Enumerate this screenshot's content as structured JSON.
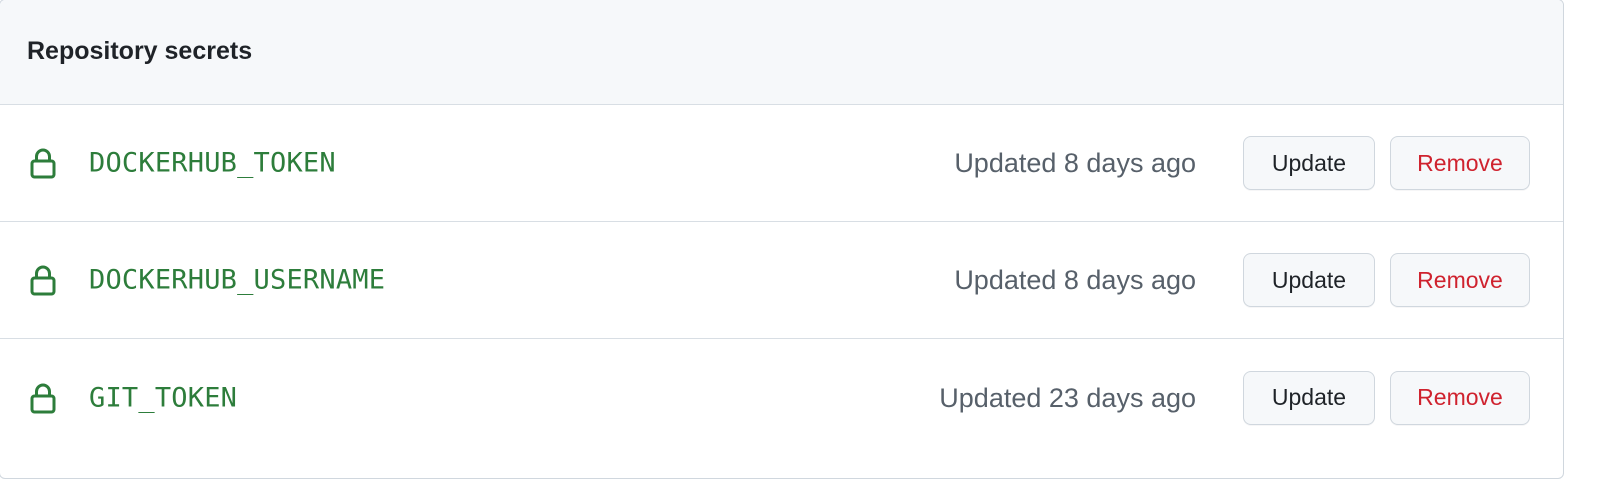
{
  "section": {
    "title": "Repository secrets"
  },
  "colors": {
    "secret_name": "#2d7d3b",
    "updated_text": "#57606a",
    "remove_text": "#cf222e",
    "header_bg": "#f6f8fa"
  },
  "secrets": [
    {
      "icon": "lock-icon",
      "name": "DOCKERHUB_TOKEN",
      "updated": "Updated 8 days ago",
      "update_label": "Update",
      "remove_label": "Remove"
    },
    {
      "icon": "lock-icon",
      "name": "DOCKERHUB_USERNAME",
      "updated": "Updated 8 days ago",
      "update_label": "Update",
      "remove_label": "Remove"
    },
    {
      "icon": "lock-icon",
      "name": "GIT_TOKEN",
      "updated": "Updated 23 days ago",
      "update_label": "Update",
      "remove_label": "Remove"
    }
  ]
}
